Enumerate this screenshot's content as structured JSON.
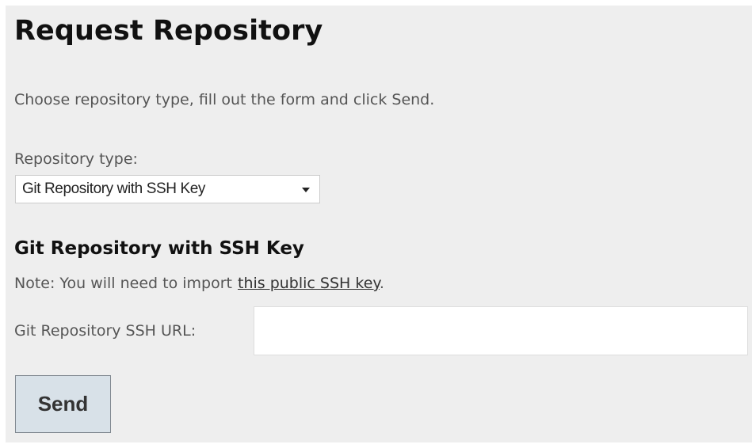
{
  "page": {
    "title": "Request Repository",
    "intro": "Choose repository type, fill out the form and click Send."
  },
  "repo_type": {
    "label": "Repository type:",
    "selected": "Git Repository with SSH Key",
    "caret_icon": "caret-down-icon"
  },
  "section": {
    "title": "Git Repository with SSH Key",
    "note_prefix": "Note: You will need to import",
    "note_link": "this public SSH key",
    "note_suffix": "."
  },
  "url_field": {
    "label": "Git Repository SSH URL:",
    "value": ""
  },
  "actions": {
    "send_label": "Send"
  },
  "colors": {
    "panel_background": "#eeeeee",
    "button_background": "#d8e1e8"
  }
}
